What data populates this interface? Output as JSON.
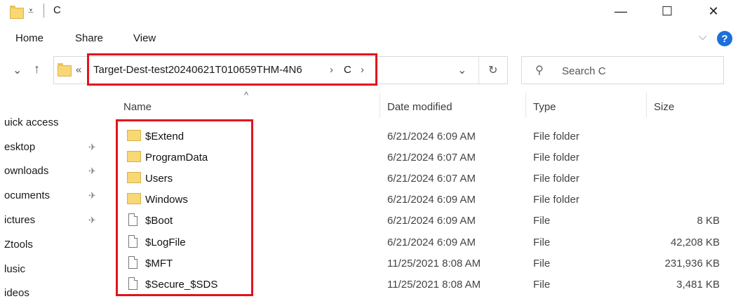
{
  "window": {
    "title": "C",
    "minimize": "—",
    "maximize": "☐",
    "close": "✕"
  },
  "ribbon": {
    "tabs": [
      "Home",
      "Share",
      "View"
    ],
    "expand": "⌵",
    "help": "?"
  },
  "nav": {
    "down": "⌄",
    "up": "↑",
    "overflow": "«",
    "refresh": "↻",
    "history": "⌄"
  },
  "breadcrumb": {
    "segments": [
      "Target-Dest-test20240621T010659THM-4N6",
      "C"
    ],
    "separator": "›"
  },
  "search": {
    "placeholder": "Search C"
  },
  "columns": {
    "name": "Name",
    "date": "Date modified",
    "type": "Type",
    "size": "Size",
    "sort": "^"
  },
  "sidebar": {
    "items": [
      {
        "label": "uick access",
        "pinned": false
      },
      {
        "label": "esktop",
        "pinned": true
      },
      {
        "label": "ownloads",
        "pinned": true
      },
      {
        "label": "ocuments",
        "pinned": true
      },
      {
        "label": "ictures",
        "pinned": true
      },
      {
        "label": "Ztools",
        "pinned": false
      },
      {
        "label": "lusic",
        "pinned": false
      },
      {
        "label": "ideos",
        "pinned": false
      }
    ],
    "pin_glyph": "✈"
  },
  "files": [
    {
      "name": "$Extend",
      "date": "6/21/2024 6:09 AM",
      "type": "File folder",
      "size": "",
      "kind": "folder"
    },
    {
      "name": "ProgramData",
      "date": "6/21/2024 6:07 AM",
      "type": "File folder",
      "size": "",
      "kind": "folder"
    },
    {
      "name": "Users",
      "date": "6/21/2024 6:07 AM",
      "type": "File folder",
      "size": "",
      "kind": "folder"
    },
    {
      "name": "Windows",
      "date": "6/21/2024 6:09 AM",
      "type": "File folder",
      "size": "",
      "kind": "folder"
    },
    {
      "name": "$Boot",
      "date": "6/21/2024 6:09 AM",
      "type": "File",
      "size": "8 KB",
      "kind": "file"
    },
    {
      "name": "$LogFile",
      "date": "6/21/2024 6:09 AM",
      "type": "File",
      "size": "42,208 KB",
      "kind": "file"
    },
    {
      "name": "$MFT",
      "date": "11/25/2021 8:08 AM",
      "type": "File",
      "size": "231,936 KB",
      "kind": "file"
    },
    {
      "name": "$Secure_$SDS",
      "date": "11/25/2021 8:08 AM",
      "type": "File",
      "size": "3,481 KB",
      "kind": "file"
    }
  ],
  "colors": {
    "highlight": "#e3121c",
    "folder": "#f8d775",
    "help": "#1e6fd9"
  }
}
